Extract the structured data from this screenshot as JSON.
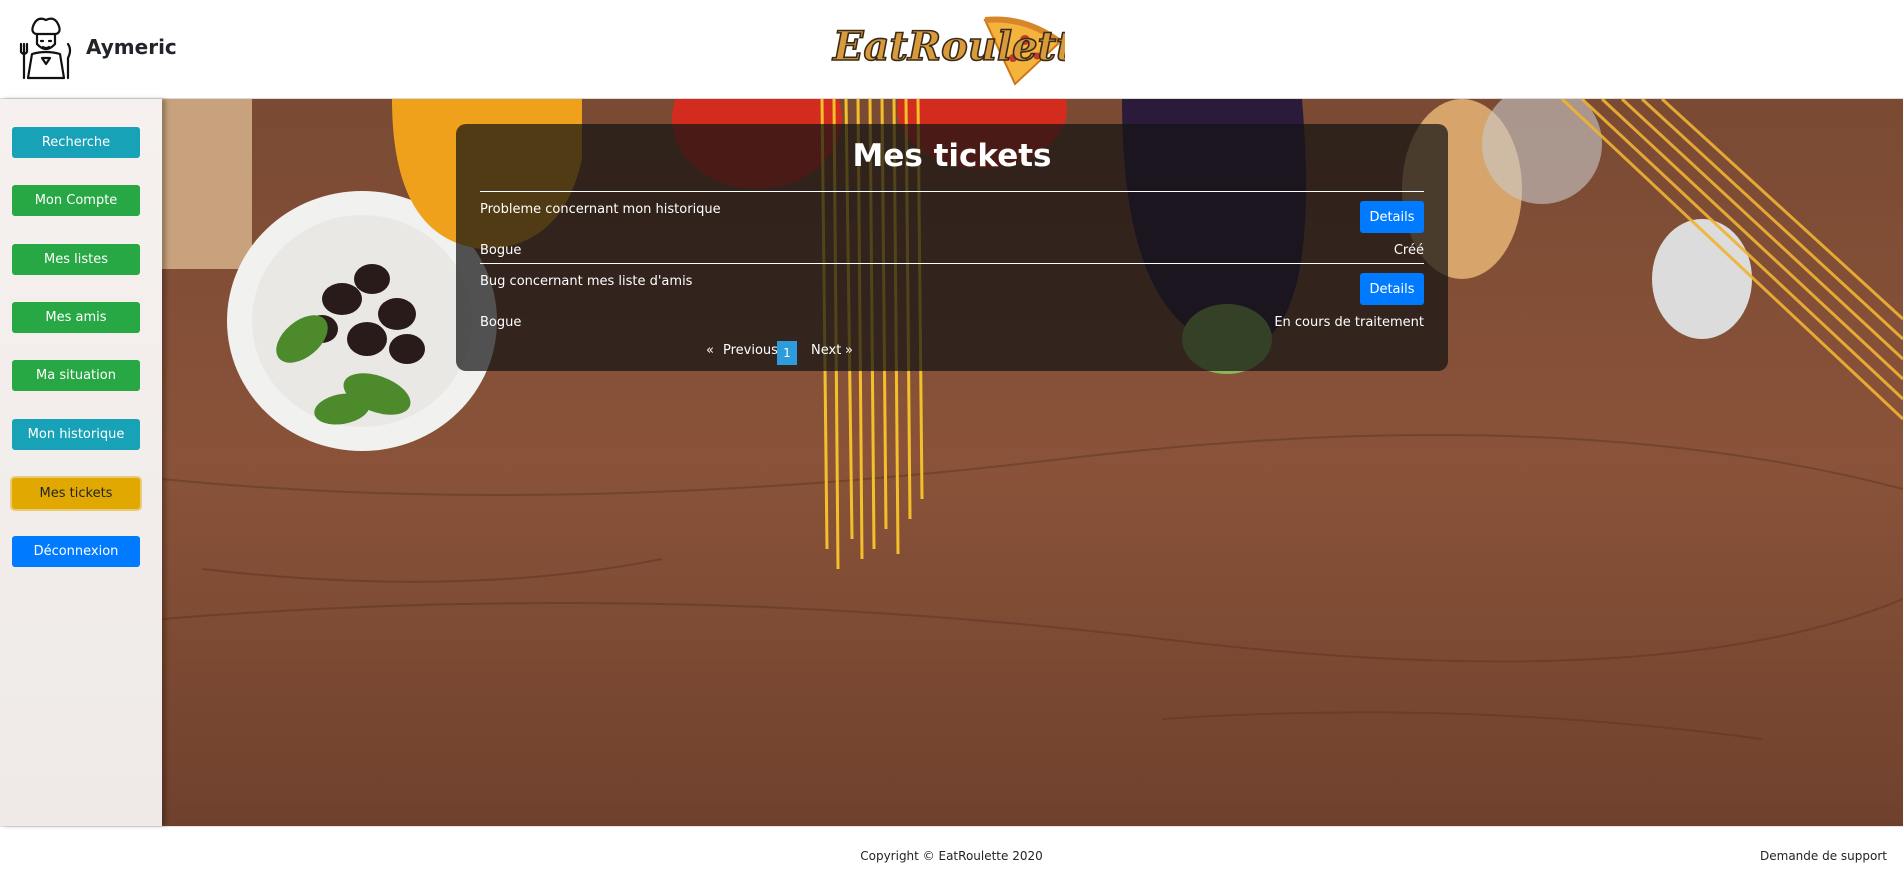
{
  "header": {
    "username": "Aymeric",
    "logo_text": "EatRoulette"
  },
  "sidebar": {
    "items": [
      {
        "label": "Recherche",
        "color": "#17a2b8"
      },
      {
        "label": "Mon Compte",
        "color": "#28a745"
      },
      {
        "label": "Mes listes",
        "color": "#28a745"
      },
      {
        "label": "Mes amis",
        "color": "#28a745"
      },
      {
        "label": "Ma situation",
        "color": "#28a745"
      },
      {
        "label": "Mon historique",
        "color": "#17a2b8"
      },
      {
        "label": "Mes tickets",
        "color": "#e0a800",
        "active": true
      },
      {
        "label": "Déconnexion",
        "color": "#007bff"
      }
    ]
  },
  "main": {
    "title": "Mes tickets",
    "tickets": [
      {
        "title": "Probleme concernant mon historique",
        "type": "Bogue",
        "status": "Créé",
        "button": "Details"
      },
      {
        "title": "Bug concernant mes liste d'amis",
        "type": "Bogue",
        "status": "En cours de traitement",
        "button": "Details"
      }
    ],
    "pagination": {
      "prev_arrow": "«",
      "previous": "Previous",
      "current": "1",
      "next": "Next",
      "next_arrow": "»"
    }
  },
  "footer": {
    "copyright": "Copyright © EatRoulette 2020",
    "support": "Demande de support"
  },
  "colors": {
    "accent_blue": "#007bff",
    "pagination_active": "#2e9bdc"
  }
}
